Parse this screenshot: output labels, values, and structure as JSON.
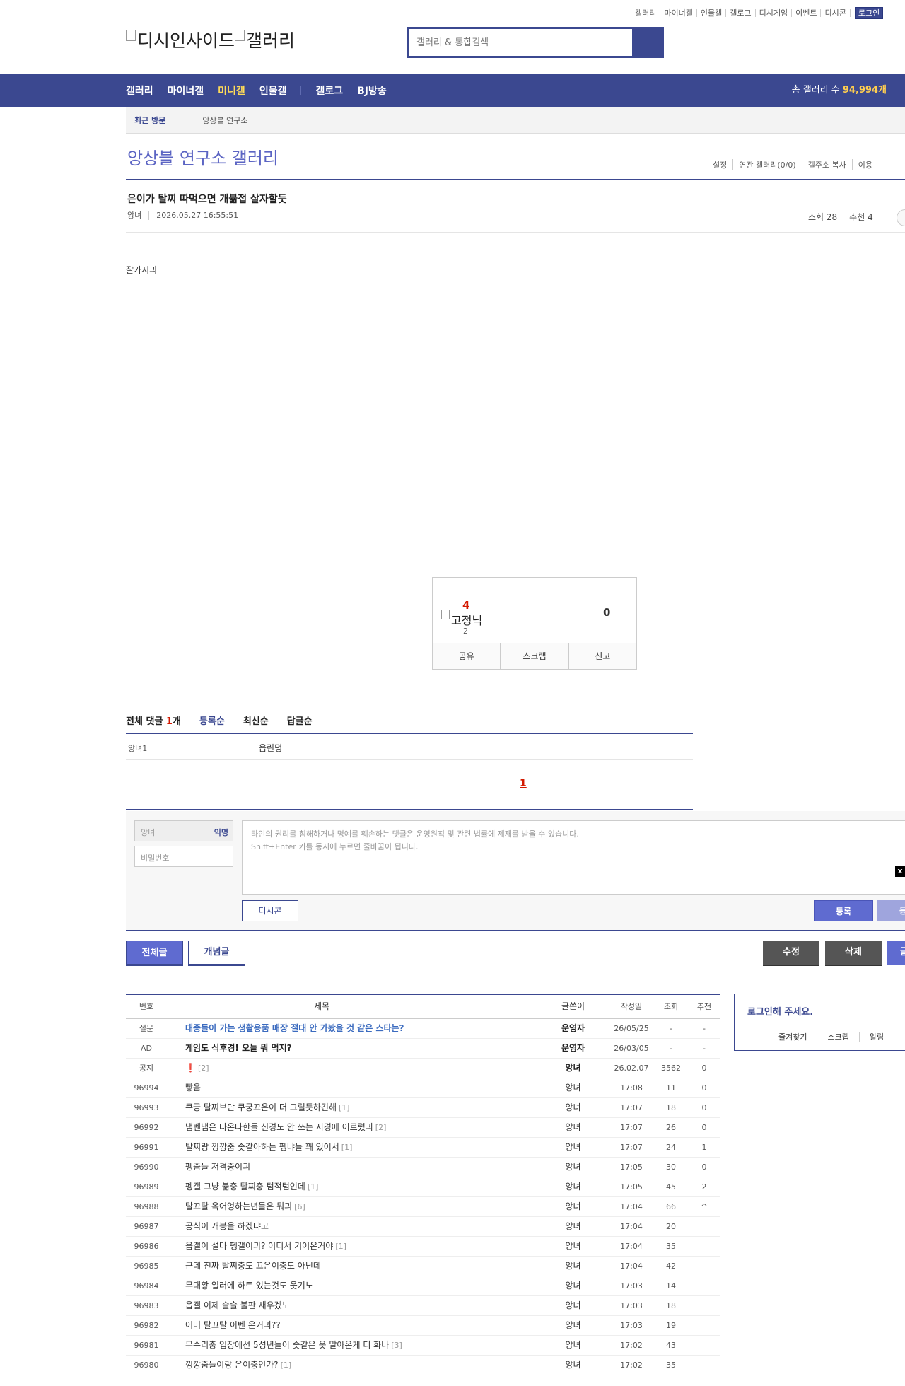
{
  "topnav": {
    "items": [
      "갤러리",
      "마이너갤",
      "인물갤",
      "갤로그",
      "디시게임",
      "이벤트",
      "디시콘"
    ],
    "login": "로그인"
  },
  "logo": {
    "alt1": "디시인사이드",
    "alt2": "갤러리"
  },
  "search": {
    "placeholder": "갤러리 & 통합검색"
  },
  "gnb": {
    "menu": [
      "갤러리",
      "마이너갤",
      "미니갤",
      "인물갤",
      "갤로그",
      "BJ방송"
    ],
    "active": "미니갤",
    "total_label": "총 갤러리 수",
    "total_value": "94,994개"
  },
  "recent": {
    "label": "최근 방문",
    "gallery": "앙상블 연구소"
  },
  "gallery": {
    "title": "앙상블 연구소 갤러리",
    "tools": [
      "설정",
      "연관 갤러리(0/0)",
      "갤주소 복사",
      "이용"
    ]
  },
  "post": {
    "title": "은이가 탈찌 따먹으면 개뷺접 살자할듯",
    "author": "앙녀",
    "datetime": "2026.05.27 16:55:51",
    "views": "조회 28",
    "recommends": "추천 4",
    "body": "잘가시긔"
  },
  "vote": {
    "up": "4",
    "down": "0",
    "fixed_alt": "고정닉",
    "fixed_count": "2",
    "buttons": [
      "공유",
      "스크랩",
      "신고"
    ]
  },
  "comments": {
    "total_label": "전체 댓글",
    "total_count": "1",
    "total_unit": "개",
    "sorts": [
      "등록순",
      "최신순",
      "답글순"
    ],
    "items": [
      {
        "nick": "앙녀1",
        "text": "읍린덩"
      }
    ],
    "page": "1"
  },
  "write": {
    "nick_placeholder": "앙녀",
    "anon": "익명",
    "pw_placeholder": "비밀번호",
    "textarea_placeholder": "타인의 권리를 침해하거나 명예를 훼손하는 댓글은 운영원칙 및 관련 법률에 제재를 받을 수 있습니다.\nShift+Enter 키를 동시에 누르면 줄바꿈이 됩니다.",
    "dccon": "디시콘",
    "submit": "등록",
    "submit2": "등록"
  },
  "close_x": "x",
  "buttons": {
    "all": "전체글",
    "best": "개념글",
    "edit": "수정",
    "delete": "삭제",
    "write": "글"
  },
  "list": {
    "headers": {
      "no": "번호",
      "title": "제목",
      "writer": "글쓴이",
      "date": "작성일",
      "views": "조회",
      "rec": "추천"
    },
    "rows": [
      {
        "no": "설문",
        "title": "대중들이 가는 생활용품 매장 절대 안 가봤을 것 같은 스타는?",
        "reply": "",
        "writer": "운영자",
        "date": "26/05/25",
        "views": "-",
        "rec": "-",
        "style": "blue"
      },
      {
        "no": "AD",
        "title": "게임도 식후경! 오늘 뭐 먹지?",
        "reply": "",
        "writer": "운영자",
        "date": "26/03/05",
        "views": "-",
        "rec": "-",
        "style": "bold"
      },
      {
        "no": "공지",
        "title": "❗",
        "reply": "[2]",
        "writer": "앙녀",
        "date": "26.02.07",
        "views": "3562",
        "rec": "0",
        "style": "notice"
      },
      {
        "no": "96994",
        "title": "빻음",
        "reply": "",
        "writer": "앙녀",
        "date": "17:08",
        "views": "11",
        "rec": "0",
        "style": ""
      },
      {
        "no": "96993",
        "title": "쿠궁 탈찌보단 쿠궁끄은이 더 그럴듯하긴해",
        "reply": "[1]",
        "writer": "앙녀",
        "date": "17:07",
        "views": "18",
        "rec": "0",
        "style": ""
      },
      {
        "no": "96992",
        "title": "냄벤냄은 나온다한들 신경도 안 쓰는 지경에 이르렀긔",
        "reply": "[2]",
        "writer": "앙녀",
        "date": "17:07",
        "views": "26",
        "rec": "0",
        "style": ""
      },
      {
        "no": "96991",
        "title": "탈찌랑 낑깡줌 좆같아하는 펭냐들 꽤 있어서",
        "reply": "[1]",
        "writer": "앙녀",
        "date": "17:07",
        "views": "24",
        "rec": "1",
        "style": ""
      },
      {
        "no": "96990",
        "title": "펭줌들 저격중이긔",
        "reply": "",
        "writer": "앙녀",
        "date": "17:05",
        "views": "30",
        "rec": "0",
        "style": ""
      },
      {
        "no": "96989",
        "title": "펭갤 그냥 뷺충 탈찌충 텀적텀인데",
        "reply": "[1]",
        "writer": "앙녀",
        "date": "17:05",
        "views": "45",
        "rec": "2",
        "style": ""
      },
      {
        "no": "96988",
        "title": "탈끄탈 옥어엉하는년들은 뭐긔",
        "reply": "[6]",
        "writer": "앙녀",
        "date": "17:04",
        "views": "66",
        "rec": "^",
        "style": ""
      },
      {
        "no": "96987",
        "title": "공식이 캐붕을 하겠냐고",
        "reply": "",
        "writer": "앙녀",
        "date": "17:04",
        "views": "20",
        "rec": "",
        "style": ""
      },
      {
        "no": "96986",
        "title": "읍갤이 설마 펭갤이긔? 어디서 기어온거야",
        "reply": "[1]",
        "writer": "앙녀",
        "date": "17:04",
        "views": "35",
        "rec": "",
        "style": ""
      },
      {
        "no": "96985",
        "title": "근데 진짜 탈찌충도 끄은이충도 아닌데",
        "reply": "",
        "writer": "앙녀",
        "date": "17:04",
        "views": "42",
        "rec": "",
        "style": ""
      },
      {
        "no": "96984",
        "title": "무대황 일러에 하트 있는것도 웃기노",
        "reply": "",
        "writer": "앙녀",
        "date": "17:03",
        "views": "14",
        "rec": "",
        "style": ""
      },
      {
        "no": "96983",
        "title": "읍갤 이제 슬슬 불판 새우겠노",
        "reply": "",
        "writer": "앙녀",
        "date": "17:03",
        "views": "18",
        "rec": "",
        "style": ""
      },
      {
        "no": "96982",
        "title": "어머 탈끄탈 이벤 온거긔??",
        "reply": "",
        "writer": "앙녀",
        "date": "17:03",
        "views": "19",
        "rec": "",
        "style": ""
      },
      {
        "no": "96981",
        "title": "무수리충 입장에선 5성년들이 좆같은 옷 말아온게 더 화나",
        "reply": "[3]",
        "writer": "앙녀",
        "date": "17:02",
        "views": "43",
        "rec": "",
        "style": ""
      },
      {
        "no": "96980",
        "title": "낑깡줌들이랑 은이충인가?",
        "reply": "[1]",
        "writer": "앙녀",
        "date": "17:02",
        "views": "35",
        "rec": "",
        "style": ""
      }
    ]
  },
  "loginbox": {
    "title": "로그인해 주세요.",
    "links": [
      "즐겨찾기",
      "스크랩",
      "알림"
    ]
  }
}
